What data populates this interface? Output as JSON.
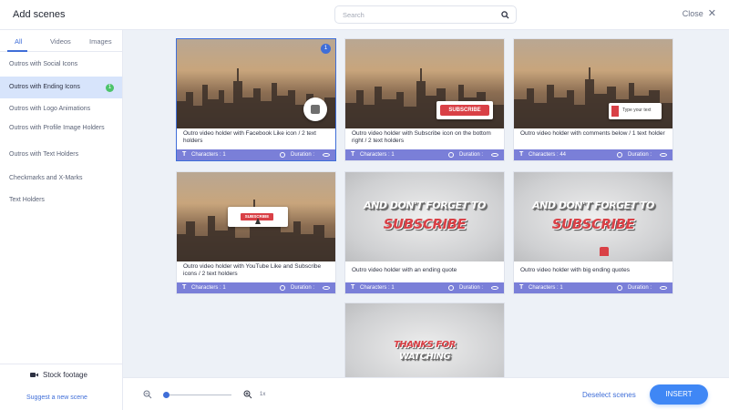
{
  "header": {
    "title": "Add scenes",
    "search_placeholder": "Search",
    "close_label": "Close",
    "close_icon": "✕"
  },
  "sidebar": {
    "tabs": [
      {
        "label": "All",
        "active": true
      },
      {
        "label": "Videos",
        "active": false
      },
      {
        "label": "Images",
        "active": false
      }
    ],
    "categories": [
      {
        "label": "Outros with Social Icons"
      },
      {
        "label": "Outros with Ending Icons",
        "badge": "1",
        "active": true
      },
      {
        "label": "Outros with Logo Animations"
      },
      {
        "label": "Outros with Profile Image Holders"
      },
      {
        "label": "Outros with Text Holders"
      },
      {
        "label": "Checkmarks and X-Marks"
      },
      {
        "label": "Text Holders"
      }
    ],
    "stock_label": "Stock footage",
    "suggest_label": "Suggest a new scene"
  },
  "cards": [
    {
      "desc": "Outro video holder with Facebook Like icon / 2 text holders",
      "chars": "Characters : 1",
      "duration": "Duration :",
      "selected": true,
      "badge": "1"
    },
    {
      "desc": "Outro video holder with Subscribe icon on the bottom right / 2 text holders",
      "chars": "Characters : 1",
      "duration": "Duration :",
      "overlay": "SUBSCRIBE"
    },
    {
      "desc": "Outro video holder with comments below / 1 text holder",
      "chars": "Characters : 44",
      "duration": "Duration :",
      "overlay": "Type your text"
    },
    {
      "desc": "Outro video holder with YouTube Like and Subscribe icons / 2 text holders",
      "chars": "Characters : 1",
      "duration": "Duration :",
      "overlay": "SUBSCRIBE"
    },
    {
      "desc": "Outro video holder with an ending quote",
      "chars": "Characters : 1",
      "duration": "Duration :",
      "quote1": "AND DON'T FORGET TO",
      "quote2": "SUBSCRIBE"
    },
    {
      "desc": "Outro video holder with big ending quotes",
      "chars": "Characters : 1",
      "duration": "Duration :",
      "quote1": "AND DON'T FORGET TO",
      "quote2": "SUBSCRIBE"
    },
    {
      "quote1": "THANKS FOR",
      "quote2": "WATCHING"
    }
  ],
  "footer": {
    "zoom_level": "1x",
    "zoom_fraction": 0.0,
    "deselect_label": "Deselect scenes",
    "insert_label": "INSERT"
  },
  "colors": {
    "accent": "#3f6ed8",
    "insert": "#3f87f5",
    "card_footer": "#7a7fd8",
    "active_category": "#d7e4fb",
    "badge_green": "#4cc36a",
    "main_bg": "#edf1f7"
  },
  "icons": {
    "search": "search-icon",
    "close": "close-icon",
    "camera": "camera-icon",
    "zoom_out": "zoom-out-icon",
    "zoom_in": "zoom-in-icon",
    "text": "text-icon",
    "clock": "clock-icon",
    "eye": "eye-icon"
  }
}
